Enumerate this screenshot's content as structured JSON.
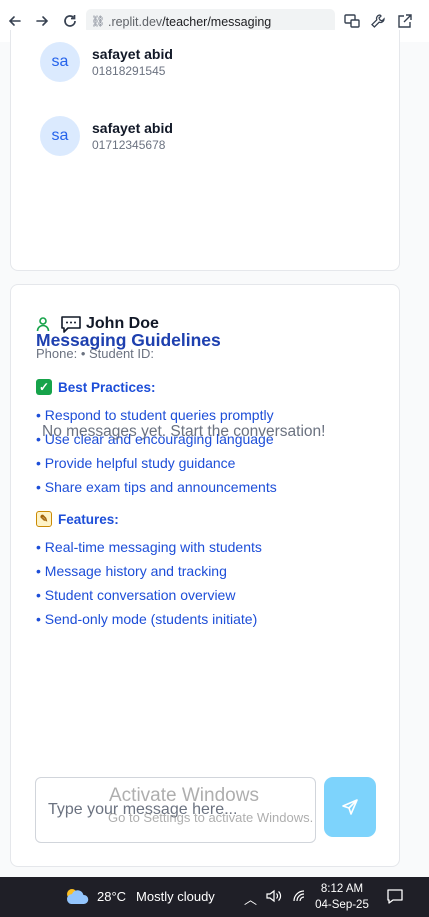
{
  "browser": {
    "url_host": ".replit.dev",
    "url_path": "/teacher/messaging",
    "back_icon": "arrow-left-icon",
    "forward_icon": "arrow-right-icon",
    "reload_icon": "reload-icon"
  },
  "contacts": [
    {
      "initials": "sa",
      "name": "safayet abid",
      "phone": "01818291545"
    },
    {
      "initials": "sa",
      "name": "safayet abid",
      "phone": "01712345678"
    }
  ],
  "chat": {
    "name": "John Doe",
    "meta": "Phone:  • Student ID:",
    "empty_state": "No messages yet. Start the conversation!",
    "input_placeholder": "Type your message here...",
    "accent_color": "#7dd3fc"
  },
  "guidelines": {
    "title": "Messaging Guidelines",
    "best_practices_title": "Best Practices:",
    "best_practices": [
      "• Respond to student queries promptly",
      "• Use clear and encouraging language",
      "• Provide helpful study guidance",
      "• Share exam tips and announcements"
    ],
    "features_title": "Features:",
    "features": [
      "• Real-time messaging with students",
      "• Message history and tracking",
      "• Student conversation overview",
      "• Send-only mode (students initiate)"
    ]
  },
  "watermark": {
    "title": "Activate Windows",
    "subtitle": "Go to Settings to activate Windows."
  },
  "taskbar": {
    "temperature": "28°C",
    "weather": "Mostly cloudy",
    "time": "8:12 AM",
    "date": "04-Sep-25"
  }
}
